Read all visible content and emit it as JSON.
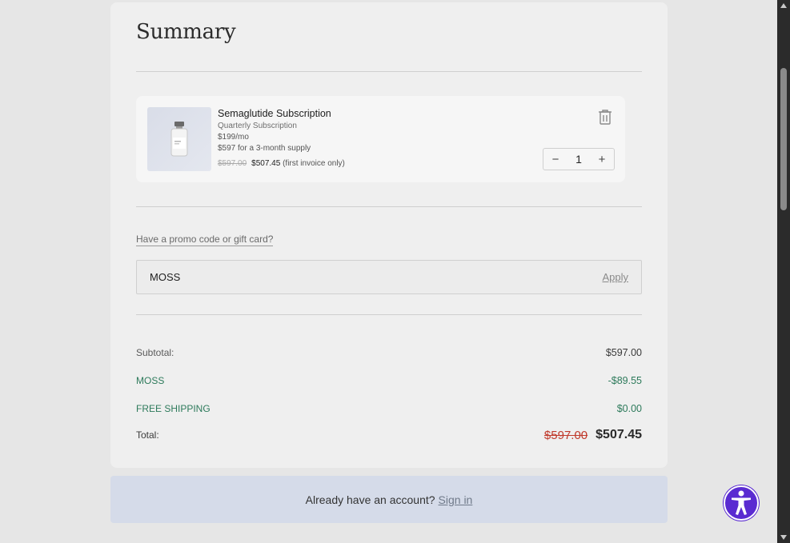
{
  "summary": {
    "title": "Summary"
  },
  "product": {
    "name": "Semaglutide Subscription",
    "plan": "Quarterly Subscription",
    "monthly_price": "$199/mo",
    "supply": "$597 for a 3-month supply",
    "old_price": "$597.00",
    "new_price": "$507.45",
    "price_note": "(first invoice only)",
    "quantity": "1",
    "thumb_icon": "vial-icon"
  },
  "promo": {
    "toggle_label": "Have a promo code or gift card?",
    "value": "MOSS",
    "apply_label": "Apply"
  },
  "totals": {
    "subtotal_label": "Subtotal:",
    "subtotal_value": "$597.00",
    "discount_label": "MOSS",
    "discount_value": "-$89.55",
    "shipping_label": "FREE SHIPPING",
    "shipping_value": "$0.00",
    "total_label": "Total:",
    "total_old": "$597.00",
    "total_new": "$507.45"
  },
  "account": {
    "prompt": "Already have an account?",
    "signin_label": "Sign in"
  },
  "colors": {
    "accent_green": "#2d7a5b",
    "strike_red": "#c0392b",
    "a11y_purple": "#5a2bd1",
    "banner_bg": "#d5dbe9"
  }
}
